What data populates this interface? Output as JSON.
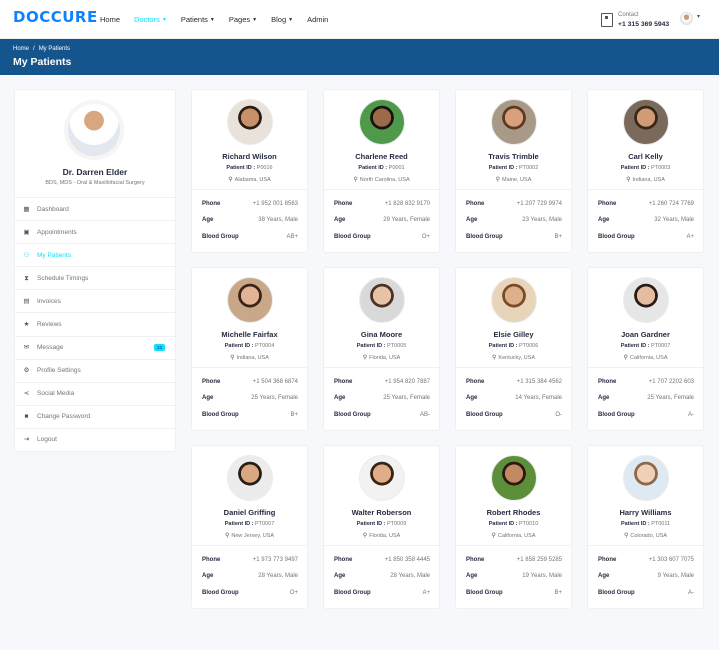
{
  "header": {
    "logo": "DOCCURE",
    "nav": [
      {
        "label": "Home",
        "dropdown": false,
        "active": false
      },
      {
        "label": "Doctors",
        "dropdown": true,
        "active": true
      },
      {
        "label": "Patients",
        "dropdown": true,
        "active": false
      },
      {
        "label": "Pages",
        "dropdown": true,
        "active": false
      },
      {
        "label": "Blog",
        "dropdown": true,
        "active": false
      },
      {
        "label": "Admin",
        "dropdown": false,
        "active": false
      }
    ],
    "contact_label": "Contact",
    "contact_phone": "+1 315 369 5943"
  },
  "banner": {
    "crumb_home": "Home",
    "crumb_sep": "/",
    "crumb_current": "My Patients",
    "title": "My Patients"
  },
  "doctor": {
    "name": "Dr. Darren Elder",
    "specialty": "BDS, MDS - Oral & Maxillofacial Surgery"
  },
  "menu": [
    {
      "label": "Dashboard",
      "icon": "columns-icon",
      "glyph": "▦"
    },
    {
      "label": "Appointments",
      "icon": "calendar-check-icon",
      "glyph": "▣"
    },
    {
      "label": "My Patients",
      "icon": "users-icon",
      "glyph": "⚇",
      "active": true
    },
    {
      "label": "Schedule Timings",
      "icon": "hourglass-icon",
      "glyph": "⧗"
    },
    {
      "label": "Invoices",
      "icon": "file-invoice-icon",
      "glyph": "▤"
    },
    {
      "label": "Reviews",
      "icon": "star-icon",
      "glyph": "★"
    },
    {
      "label": "Message",
      "icon": "comments-icon",
      "glyph": "✉",
      "badge": "23"
    },
    {
      "label": "Profile Settings",
      "icon": "user-cog-icon",
      "glyph": "⚙"
    },
    {
      "label": "Social Media",
      "icon": "share-icon",
      "glyph": "⋖"
    },
    {
      "label": "Change Password",
      "icon": "lock-icon",
      "glyph": "■"
    },
    {
      "label": "Logout",
      "icon": "sign-out-icon",
      "glyph": "⇥"
    }
  ],
  "labels": {
    "patient_id": "Patient ID :",
    "phone": "Phone",
    "age": "Age",
    "blood": "Blood Group"
  },
  "patients": [
    {
      "name": "Richard Wilson",
      "id": "P0016",
      "location": "Alabama, USA",
      "phone": "+1 952 001 8563",
      "age": "38 Years, Male",
      "blood": "AB+",
      "skin": "#c9916a",
      "hair": "#2b1d14",
      "bg": "#e8e2da"
    },
    {
      "name": "Charlene Reed",
      "id": "P0001",
      "location": "North Carolina, USA",
      "phone": "+1 828 632 9170",
      "age": "29 Years, Female",
      "blood": "O+",
      "skin": "#9b6a48",
      "hair": "#1a1210",
      "bg": "#4f9a4a"
    },
    {
      "name": "Travis Trimble",
      "id": "PT0002",
      "location": "Maine, USA",
      "phone": "+1 207 729 9974",
      "age": "23 Years, Male",
      "blood": "B+",
      "skin": "#d8a07d",
      "hair": "#5c3a22",
      "bg": "#a89a86"
    },
    {
      "name": "Carl Kelly",
      "id": "PT0003",
      "location": "Indiana, USA",
      "phone": "+1 260 724 7769",
      "age": "32 Years, Male",
      "blood": "A+",
      "skin": "#d29b78",
      "hair": "#3a2716",
      "bg": "#7a6a5c"
    },
    {
      "name": "Michelle Fairfax",
      "id": "PT0004",
      "location": "Indiana, USA",
      "phone": "+1 504 368 6874",
      "age": "25 Years, Female",
      "blood": "B+",
      "skin": "#e2b496",
      "hair": "#3b2418",
      "bg": "#c9a88a"
    },
    {
      "name": "Gina Moore",
      "id": "PT0005",
      "location": "Florida, USA",
      "phone": "+1 954 820 7887",
      "age": "25 Years, Female",
      "blood": "AB-",
      "skin": "#e6c2a6",
      "hair": "#4a3324",
      "bg": "#d9d9d9"
    },
    {
      "name": "Elsie Gilley",
      "id": "PT0006",
      "location": "Kentucky, USA",
      "phone": "+1 315 384 4562",
      "age": "14 Years, Female",
      "blood": "O-",
      "skin": "#ddb08c",
      "hair": "#7a4c2a",
      "bg": "#e8d4b8"
    },
    {
      "name": "Joan Gardner",
      "id": "PT0007",
      "location": "California, USA",
      "phone": "+1 707 2202 603",
      "age": "25 Years, Female",
      "blood": "A-",
      "skin": "#e4bda0",
      "hair": "#2a1c14",
      "bg": "#e6e6e6"
    },
    {
      "name": "Daniel Griffing",
      "id": "PT0007",
      "location": "New Jersey, USA",
      "phone": "+1 973 773 9497",
      "age": "28 Years, Male",
      "blood": "O+",
      "skin": "#d9a882",
      "hair": "#2b1d14",
      "bg": "#ececec"
    },
    {
      "name": "Walter Roberson",
      "id": "PT0009",
      "location": "Florida, USA",
      "phone": "+1 850 358 4445",
      "age": "28 Years, Male",
      "blood": "A+",
      "skin": "#e0ad8a",
      "hair": "#3a2414",
      "bg": "#f2f2f2"
    },
    {
      "name": "Robert Rhodes",
      "id": "PT0010",
      "location": "California, USA",
      "phone": "+1 858 259 5285",
      "age": "19 Years, Male",
      "blood": "B+",
      "skin": "#c18a62",
      "hair": "#2a1a10",
      "bg": "#5d8f3a"
    },
    {
      "name": "Harry Williams",
      "id": "PT0011",
      "location": "Colorado, USA",
      "phone": "+1 303 607 7075",
      "age": "9 Years, Male",
      "blood": "A-",
      "skin": "#f0d0b6",
      "hair": "#8a6a4a",
      "bg": "#dfe9f2"
    }
  ]
}
